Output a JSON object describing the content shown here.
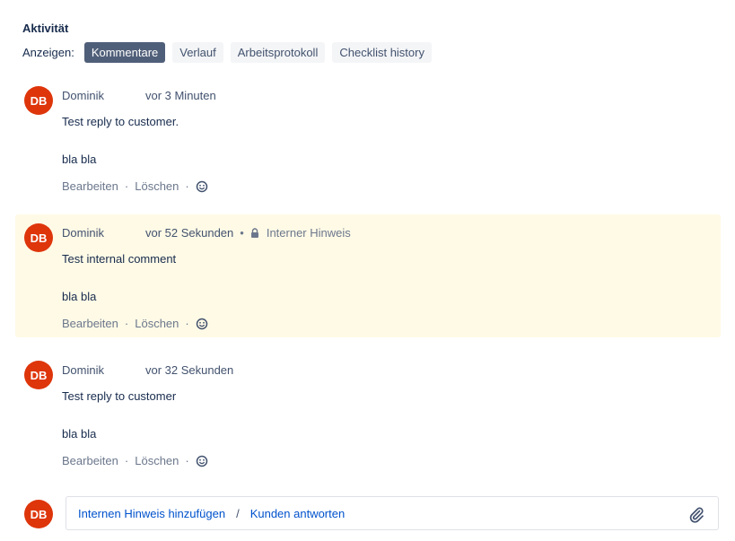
{
  "activity": {
    "title": "Aktivität",
    "show_label": "Anzeigen:",
    "tabs": [
      {
        "label": "Kommentare",
        "active": true
      },
      {
        "label": "Verlauf",
        "active": false
      },
      {
        "label": "Arbeitsprotokoll",
        "active": false
      },
      {
        "label": "Checklist history",
        "active": false
      }
    ]
  },
  "comments": [
    {
      "initials": "DB",
      "author": "Dominik",
      "time": "vor 3 Minuten",
      "internal": false,
      "lines": [
        "Test reply to customer.",
        "bla bla"
      ],
      "edit_label": "Bearbeiten",
      "delete_label": "Löschen"
    },
    {
      "initials": "DB",
      "author": "Dominik",
      "time": "vor 52 Sekunden",
      "internal": true,
      "internal_label": "Interner Hinweis",
      "lines": [
        "Test internal comment",
        "bla bla"
      ],
      "edit_label": "Bearbeiten",
      "delete_label": "Löschen"
    },
    {
      "initials": "DB",
      "author": "Dominik",
      "time": "vor 32 Sekunden",
      "internal": false,
      "lines": [
        "Test reply to customer",
        "bla bla"
      ],
      "edit_label": "Bearbeiten",
      "delete_label": "Löschen"
    }
  ],
  "composer": {
    "initials": "DB",
    "internal_note_link": "Internen Hinweis hinzufügen",
    "separator": "/",
    "reply_customer_link": "Kunden antworten"
  },
  "icons": {
    "reaction": "smiley-icon",
    "lock": "lock-icon",
    "attach": "paperclip-icon"
  },
  "colors": {
    "avatar": "#de350b",
    "active_tab": "#505f79",
    "internal_bg": "#fffae6",
    "link": "#0052cc"
  }
}
